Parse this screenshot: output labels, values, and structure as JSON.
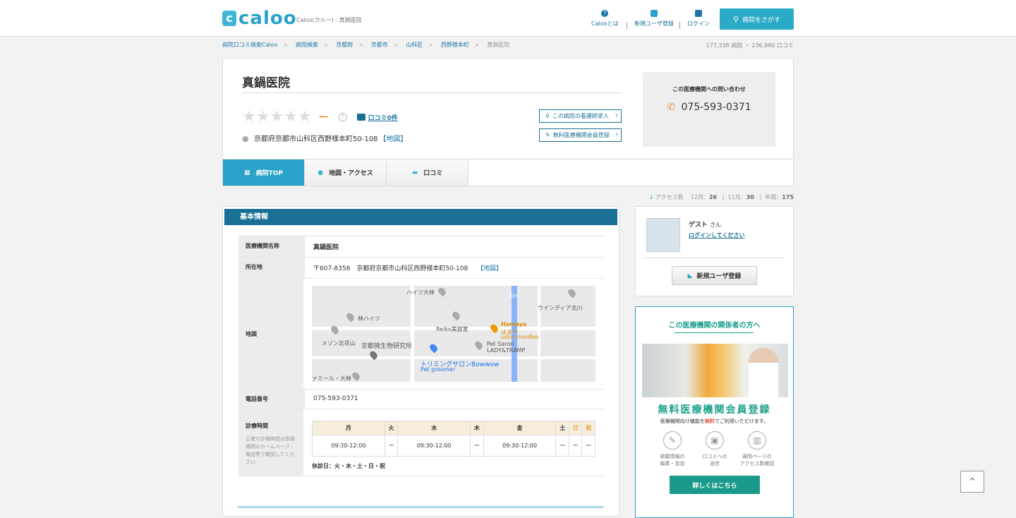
{
  "header": {
    "logo_mark": "c",
    "logo_text": "caloo",
    "logo_sub": "Caloo(カルー) - 真鍋医院",
    "nav": [
      {
        "label": "Calooとは",
        "icon": "question-icon"
      },
      {
        "label": "新規ユーザ登録",
        "icon": "beginner-mark-icon"
      },
      {
        "label": "ログイン",
        "icon": "lock-icon"
      }
    ],
    "search_label": "病院をさがす"
  },
  "breadcrumb": [
    "病院口コミ検索Caloo",
    "病院検索",
    "京都府",
    "京都市",
    "山科区",
    "西野様本町",
    "真鍋医院"
  ],
  "counts": "177,338 病院 ・ 236,880 口コミ",
  "hospital": {
    "name": "真鍋医院",
    "rating_dash": "ー",
    "qmark": "?",
    "reviews_link": "口コミ0件",
    "address": "京都府京都市山科区西野様本町50-108",
    "map_link": "【地図】",
    "btn_nurse": "この病院の看護師求人",
    "btn_member": "無料医療機関会員登録"
  },
  "contact": {
    "title": "この医療機関への問い合わせ",
    "phone": "075-593-0371"
  },
  "tabs": [
    "病院TOP",
    "地図・アクセス",
    "口コミ"
  ],
  "access": {
    "label": "アクセス数",
    "dec_label": "12月：",
    "dec": "26",
    "nov_label": "11月：",
    "nov": "30",
    "year_label": "年間：",
    "year": "175"
  },
  "basic": {
    "heading": "基本情報",
    "name_label": "医療機関名称",
    "name": "真鍋医院",
    "addr_label": "所在地",
    "addr": "〒607-8358　京都府京都市山科区西野様本町50-108",
    "addr_map": "【地図】",
    "map_label": "地図",
    "map_places": [
      "ハイツ大林",
      "林ハイツ",
      "Reiko美容室",
      "Hamaya",
      "はまや",
      "udon noodles",
      "ウインディア北川",
      "メゾン北花山",
      "京都微生物研究所",
      "Pet Saron",
      "LADY&TRAMP",
      "トリミングサロンBowwow",
      "Pet groomer",
      "ァミール・大林",
      "Kyo"
    ],
    "tel_label": "電話番号",
    "tel": "075-593-0371",
    "hours_label": "診療時間",
    "hours_note": "正確な診療時間は医療機関のホームページ・電話等で確認してください",
    "days": [
      "月",
      "火",
      "水",
      "木",
      "金",
      "土",
      "日",
      "祝"
    ],
    "times": [
      "09:30-12:00",
      "ー",
      "09:30-12:00",
      "ー",
      "09:30-12:00",
      "ー",
      "ー",
      "ー"
    ],
    "holiday": "休診日：火・木・土・日・祝"
  },
  "user": {
    "name": "ゲスト",
    "suffix": "さん",
    "login": "ログインしてください",
    "register": "新規ユーザ登録"
  },
  "promo": {
    "title": "この医療機関の関係者の方へ",
    "big": "無料医療機関会員登録",
    "small_pre": "医療機関向け機能を",
    "small_em": "無料",
    "small_post": "でご利用いただけます。",
    "features": [
      {
        "icon": "pencil-icon",
        "l1": "掲載情報の",
        "l2": "編集・追加"
      },
      {
        "icon": "chat-icon",
        "l1": "口コミへの",
        "l2": "返信"
      },
      {
        "icon": "bar-chart-icon",
        "l1": "貴院ページの",
        "l2": "アクセス数確認"
      }
    ],
    "more": "詳しくはこちら"
  },
  "totop": "^"
}
